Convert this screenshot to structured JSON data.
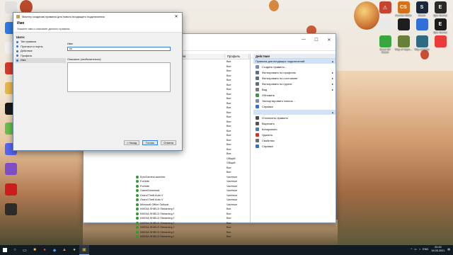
{
  "desktop": {
    "left_icons": [
      {
        "label": "",
        "color": "#e0e0e0"
      },
      {
        "label": "",
        "color": "#2f7be6"
      },
      {
        "label": "",
        "color": "#f2f2f2"
      },
      {
        "label": "",
        "color": "#d83b2a"
      },
      {
        "label": "",
        "color": "#e9b949"
      },
      {
        "label": "",
        "color": "#1a1a1a"
      },
      {
        "label": "",
        "color": "#66c14d"
      },
      {
        "label": "",
        "color": "#5865f2"
      },
      {
        "label": "",
        "color": "#7c4dc4"
      },
      {
        "label": "",
        "color": "#cc1d1d"
      },
      {
        "label": "",
        "color": "#2c2c2c"
      }
    ],
    "right_icons": [
      {
        "label": "",
        "color": "#c6432f",
        "glyph": "⚠"
      },
      {
        "label": "Counter-Strike",
        "color": "#d5701d",
        "glyph": "CS"
      },
      {
        "label": "Steam",
        "color": "#1b2838",
        "glyph": "S"
      },
      {
        "label": "Epic Games",
        "color": "#2a2a2a",
        "glyph": "E"
      },
      {
        "label": "",
        "color": "#e9e9e9",
        "glyph": ""
      },
      {
        "label": "",
        "color": "#1e1e1e",
        "glyph": ""
      },
      {
        "label": "",
        "color": "#2e6fd8",
        "glyph": ""
      },
      {
        "label": "Epic Games",
        "color": "#1c1c1c",
        "glyph": "E"
      },
      {
        "label": "Brawl Sill Steam",
        "color": "#3aa642",
        "glyph": ""
      },
      {
        "label": "Way of Valpo...",
        "color": "#66803a",
        "glyph": ""
      },
      {
        "label": "Way of Valpo",
        "color": "#2c6b82",
        "glyph": ""
      },
      {
        "label": "",
        "color": "#ea3b3b",
        "glyph": ""
      }
    ]
  },
  "firewall": {
    "columns": [
      "Имя",
      "Группа",
      "Профиль"
    ],
    "rows": [
      {
        "name": "",
        "profile": "Все"
      },
      {
        "name": "",
        "profile": "Все"
      },
      {
        "name": "",
        "profile": "Все"
      },
      {
        "name": "",
        "profile": "Все"
      },
      {
        "name": "",
        "profile": "Все"
      },
      {
        "name": "",
        "profile": "Все"
      },
      {
        "name": "",
        "profile": "Все"
      },
      {
        "name": "",
        "profile": "Все"
      },
      {
        "name": "",
        "profile": "Все"
      },
      {
        "name": "",
        "profile": "Все"
      },
      {
        "name": "",
        "profile": "Все"
      },
      {
        "name": "",
        "profile": "Все"
      },
      {
        "name": "",
        "profile": "Все"
      },
      {
        "name": "",
        "profile": "Все"
      },
      {
        "name": "",
        "profile": "Все"
      },
      {
        "name": "",
        "profile": "Все"
      },
      {
        "name": "",
        "profile": "Все"
      },
      {
        "name": "",
        "profile": "Все"
      },
      {
        "name": "",
        "profile": "Все"
      },
      {
        "name": "",
        "profile": "Все"
      },
      {
        "name": "",
        "profile": "Все"
      },
      {
        "name": "",
        "profile": "Общий"
      },
      {
        "name": "",
        "profile": "Общий"
      },
      {
        "name": "",
        "profile": "Все"
      },
      {
        "name": "",
        "profile": "Все"
      },
      {
        "name": "EpicGamesLauncher",
        "profile": "Частные"
      },
      {
        "name": "Fortnite",
        "profile": "Частные"
      },
      {
        "name": "Fortnite",
        "profile": "Частные"
      },
      {
        "name": "GameDownload",
        "profile": "Частные"
      },
      {
        "name": "Grand Theft Auto V",
        "profile": "Частные"
      },
      {
        "name": "Grand Theft Auto V",
        "profile": "Частные"
      },
      {
        "name": "Microsoft Office Outlook",
        "profile": "Частные"
      },
      {
        "name": "NVIDIA SHIELD Streaming NSS TCP Exce...",
        "profile": "Все"
      },
      {
        "name": "NVIDIA SHIELD Streaming NSS UDP Exce...",
        "profile": "Все"
      },
      {
        "name": "NVIDIA SHIELD Streaming NvStreamer Ex...",
        "profile": "Все"
      },
      {
        "name": "NVIDIA SHIELD Streaming NvStreamer U...",
        "profile": "Все"
      },
      {
        "name": "NVIDIA SHIELD Streaming SSAU TCP Exce...",
        "profile": "Все"
      },
      {
        "name": "NVIDIA SHIELD Streaming SSAU UDP Exce...",
        "profile": "Все"
      },
      {
        "name": "NVIDIA SHIELD Streaming SSAU UDP Exce...",
        "profile": "Все"
      }
    ],
    "actions_header": "Действия",
    "actions_section": "Правила для входящих подключений",
    "actions": [
      {
        "label": "Создать правило...",
        "icon": "new-rule-icon",
        "color": "#6e8cc8",
        "arrow": ""
      },
      {
        "label": "Фильтровать по профилю",
        "icon": "filter-icon",
        "color": "#5b6f86",
        "arrow": "▸"
      },
      {
        "label": "Фильтровать по состоянию",
        "icon": "filter-icon",
        "color": "#5b6f86",
        "arrow": "▸"
      },
      {
        "label": "Фильтровать по группе",
        "icon": "filter-icon",
        "color": "#5b6f86",
        "arrow": "▸"
      },
      {
        "label": "Вид",
        "icon": "view-icon",
        "color": "#7a7a7a",
        "arrow": "▸"
      },
      {
        "label": "Обновить",
        "icon": "refresh-icon",
        "color": "#3f9a3f",
        "arrow": ""
      },
      {
        "label": "Экспортировать список...",
        "icon": "export-icon",
        "color": "#7a8da6",
        "arrow": ""
      },
      {
        "label": "Справка",
        "icon": "help-icon",
        "color": "#2e6fd8",
        "arrow": ""
      }
    ],
    "actions_section2": "",
    "actions2": [
      {
        "label": "Отключить правило",
        "icon": "disable-icon",
        "color": "#4a4a4a"
      },
      {
        "label": "Вырезать",
        "icon": "cut-icon",
        "color": "#555"
      },
      {
        "label": "Копировать",
        "icon": "copy-icon",
        "color": "#5777a6"
      },
      {
        "label": "Удалить",
        "icon": "delete-icon",
        "color": "#d42e2e"
      },
      {
        "label": "Свойства",
        "icon": "properties-icon",
        "color": "#6d6d6d"
      },
      {
        "label": "Справка",
        "icon": "help-icon",
        "color": "#2e6fd8"
      }
    ]
  },
  "wizard": {
    "title": "Мастер создания правила для нового входящего подключения",
    "heading": "Имя",
    "subheading": "Укажите имя и описание данного правила.",
    "steps_header": "Шаги:",
    "steps": [
      {
        "label": "Тип правила",
        "selected": false
      },
      {
        "label": "Протокол и порты",
        "selected": false
      },
      {
        "label": "Действие",
        "selected": false
      },
      {
        "label": "Профиль",
        "selected": false
      },
      {
        "label": "Имя",
        "selected": true
      }
    ],
    "name_label": "Имя:",
    "name_value": "cs",
    "desc_label": "Описание (необязательно):",
    "back_label": "< Назад",
    "finish_label": "Готово",
    "cancel_label": "Отмена"
  },
  "taskbar": {
    "lang": "ENG",
    "time": "20:15",
    "date": "16.05.2021"
  }
}
